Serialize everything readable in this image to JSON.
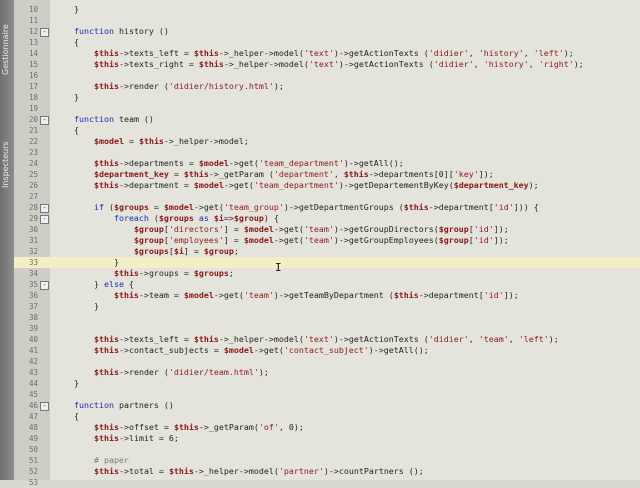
{
  "sidebar": {
    "tabs": [
      {
        "label": "Gestionnaire"
      },
      {
        "label": "Inspecteurs"
      }
    ]
  },
  "lines": [
    {
      "n": "10",
      "fold": "",
      "text": "    }",
      "hl": false
    },
    {
      "n": "11",
      "fold": "",
      "text": "",
      "hl": false
    },
    {
      "n": "12",
      "fold": "-",
      "text": "    function history ()",
      "hl": false
    },
    {
      "n": "13",
      "fold": "",
      "text": "    {",
      "hl": false
    },
    {
      "n": "14",
      "fold": "",
      "text": "        $this->texts_left = $this->_helper->model('text')->getActionTexts ('didier', 'history', 'left');",
      "hl": false
    },
    {
      "n": "15",
      "fold": "",
      "text": "        $this->texts_right = $this->_helper->model('text')->getActionTexts ('didier', 'history', 'right');",
      "hl": false
    },
    {
      "n": "16",
      "fold": "",
      "text": "",
      "hl": false
    },
    {
      "n": "17",
      "fold": "",
      "text": "        $this->render ('didier/history.html');",
      "hl": false
    },
    {
      "n": "18",
      "fold": "",
      "text": "    }",
      "hl": false
    },
    {
      "n": "19",
      "fold": "",
      "text": "",
      "hl": false
    },
    {
      "n": "20",
      "fold": "-",
      "text": "    function team ()",
      "hl": false
    },
    {
      "n": "21",
      "fold": "",
      "text": "    {",
      "hl": false
    },
    {
      "n": "22",
      "fold": "",
      "text": "        $model = $this->_helper->model;",
      "hl": false
    },
    {
      "n": "23",
      "fold": "",
      "text": "",
      "hl": false
    },
    {
      "n": "24",
      "fold": "",
      "text": "        $this->departments = $model->get('team_department')->getAll();",
      "hl": false
    },
    {
      "n": "25",
      "fold": "",
      "text": "        $department_key = $this->_getParam ('department', $this->departments[0]['key']);",
      "hl": false
    },
    {
      "n": "26",
      "fold": "",
      "text": "        $this->department = $model->get('team_department')->getDepartementByKey($department_key);",
      "hl": false
    },
    {
      "n": "27",
      "fold": "",
      "text": "",
      "hl": false
    },
    {
      "n": "28",
      "fold": "-",
      "text": "        if ($groups = $model->get('team_group')->getDepartmentGroups ($this->department['id'])) {",
      "hl": false
    },
    {
      "n": "29",
      "fold": "-",
      "text": "            foreach ($groups as $i=>$group) {",
      "hl": false
    },
    {
      "n": "30",
      "fold": "",
      "text": "                $group['directors'] = $model->get('team')->getGroupDirectors($group['id']);",
      "hl": false
    },
    {
      "n": "31",
      "fold": "",
      "text": "                $group['employees'] = $model->get('team')->getGroupEmployees($group['id']);",
      "hl": false
    },
    {
      "n": "32",
      "fold": "",
      "text": "                $groups[$i] = $group;",
      "hl": false
    },
    {
      "n": "33",
      "fold": "",
      "text": "            }",
      "hl": true
    },
    {
      "n": "34",
      "fold": "",
      "text": "            $this->groups = $groups;",
      "hl": false
    },
    {
      "n": "35",
      "fold": "-",
      "text": "        } else {",
      "hl": false
    },
    {
      "n": "36",
      "fold": "",
      "text": "            $this->team = $model->get('team')->getTeamByDepartment ($this->department['id']);",
      "hl": false
    },
    {
      "n": "37",
      "fold": "",
      "text": "        }",
      "hl": false
    },
    {
      "n": "38",
      "fold": "",
      "text": "",
      "hl": false
    },
    {
      "n": "39",
      "fold": "",
      "text": "",
      "hl": false
    },
    {
      "n": "40",
      "fold": "",
      "text": "        $this->texts_left = $this->_helper->model('text')->getActionTexts ('didier', 'team', 'left');",
      "hl": false
    },
    {
      "n": "41",
      "fold": "",
      "text": "        $this->contact_subjects = $model->get('contact_subject')->getAll();",
      "hl": false
    },
    {
      "n": "42",
      "fold": "",
      "text": "",
      "hl": false
    },
    {
      "n": "43",
      "fold": "",
      "text": "        $this->render ('didier/team.html');",
      "hl": false
    },
    {
      "n": "44",
      "fold": "",
      "text": "    }",
      "hl": false
    },
    {
      "n": "45",
      "fold": "",
      "text": "",
      "hl": false
    },
    {
      "n": "46",
      "fold": "-",
      "text": "    function partners ()",
      "hl": false
    },
    {
      "n": "47",
      "fold": "",
      "text": "    {",
      "hl": false
    },
    {
      "n": "48",
      "fold": "",
      "text": "        $this->offset = $this->_getParam('of', 0);",
      "hl": false
    },
    {
      "n": "49",
      "fold": "",
      "text": "        $this->limit = 6;",
      "hl": false
    },
    {
      "n": "50",
      "fold": "",
      "text": "",
      "hl": false
    },
    {
      "n": "51",
      "fold": "",
      "text": "        # paper",
      "hl": false
    },
    {
      "n": "52",
      "fold": "",
      "text": "        $this->total = $this->_helper->model('partner')->countPartners ();",
      "hl": false
    },
    {
      "n": "53",
      "fold": "",
      "text": "",
      "hl": false
    }
  ],
  "colors": {
    "keyword": "#1a2ab8",
    "variable": "#8a1616",
    "string": "#8a1a1a",
    "highlight_line": "#f1efc3"
  }
}
